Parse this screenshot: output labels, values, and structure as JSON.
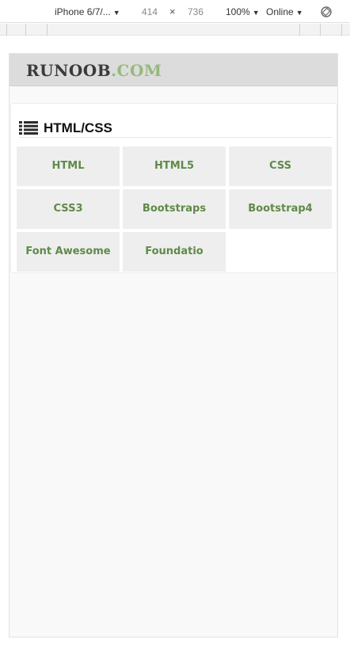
{
  "devtools": {
    "device": "iPhone 6/7/...",
    "width": "414",
    "times": "×",
    "height": "736",
    "zoom": "100%",
    "network": "Online",
    "caret": "▼"
  },
  "site": {
    "logo_main": "RUNOOB",
    "logo_suffix": ".COM",
    "colors": {
      "logo_suffix": "#96b97d",
      "tile_text": "#5f8a48",
      "tile_bg": "#eeeeee",
      "header_bg": "#dcdcdc"
    }
  },
  "panel": {
    "icon": "list-icon",
    "title": "HTML/CSS",
    "tiles": [
      "HTML",
      "HTML5",
      "CSS",
      "CSS3",
      "Bootstraps",
      "Bootstrap4",
      "Font Awesome",
      "Foundatio"
    ]
  }
}
